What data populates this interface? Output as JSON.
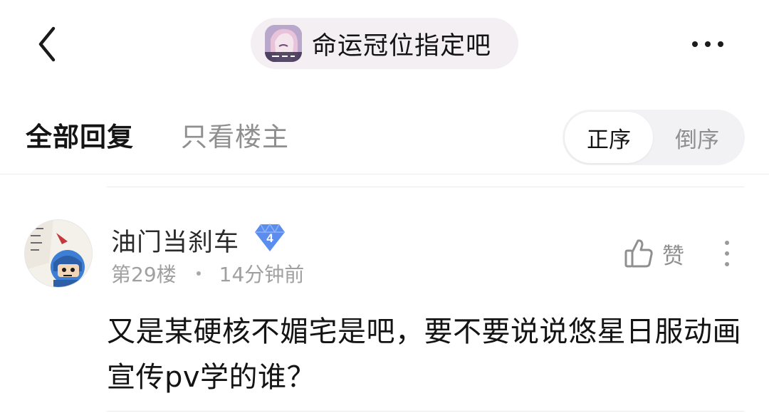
{
  "header": {
    "back_icon": "chevron-left-icon",
    "forum_name": "命运冠位指定吧",
    "more_icon": "more-horizontal-icon"
  },
  "tabs": {
    "all_replies": "全部回复",
    "op_only": "只看楼主",
    "active": "全部回复"
  },
  "sort": {
    "ascending": "正序",
    "descending": "倒序",
    "selected": "正序"
  },
  "reply": {
    "username": "油门当刹车",
    "level": "4",
    "floor": "第29楼",
    "time": "14分钟前",
    "like_label": "赞",
    "like_icon": "thumbs-up-icon",
    "more_icon": "more-vertical-icon",
    "content": "又是某硬核不媚宅是吧，要不要说说悠星日服动画宣传pv学的谁？"
  },
  "colors": {
    "pill_background": "#f4eff3",
    "level_badge": "#5b8def",
    "muted_text": "#8f8f8f"
  }
}
